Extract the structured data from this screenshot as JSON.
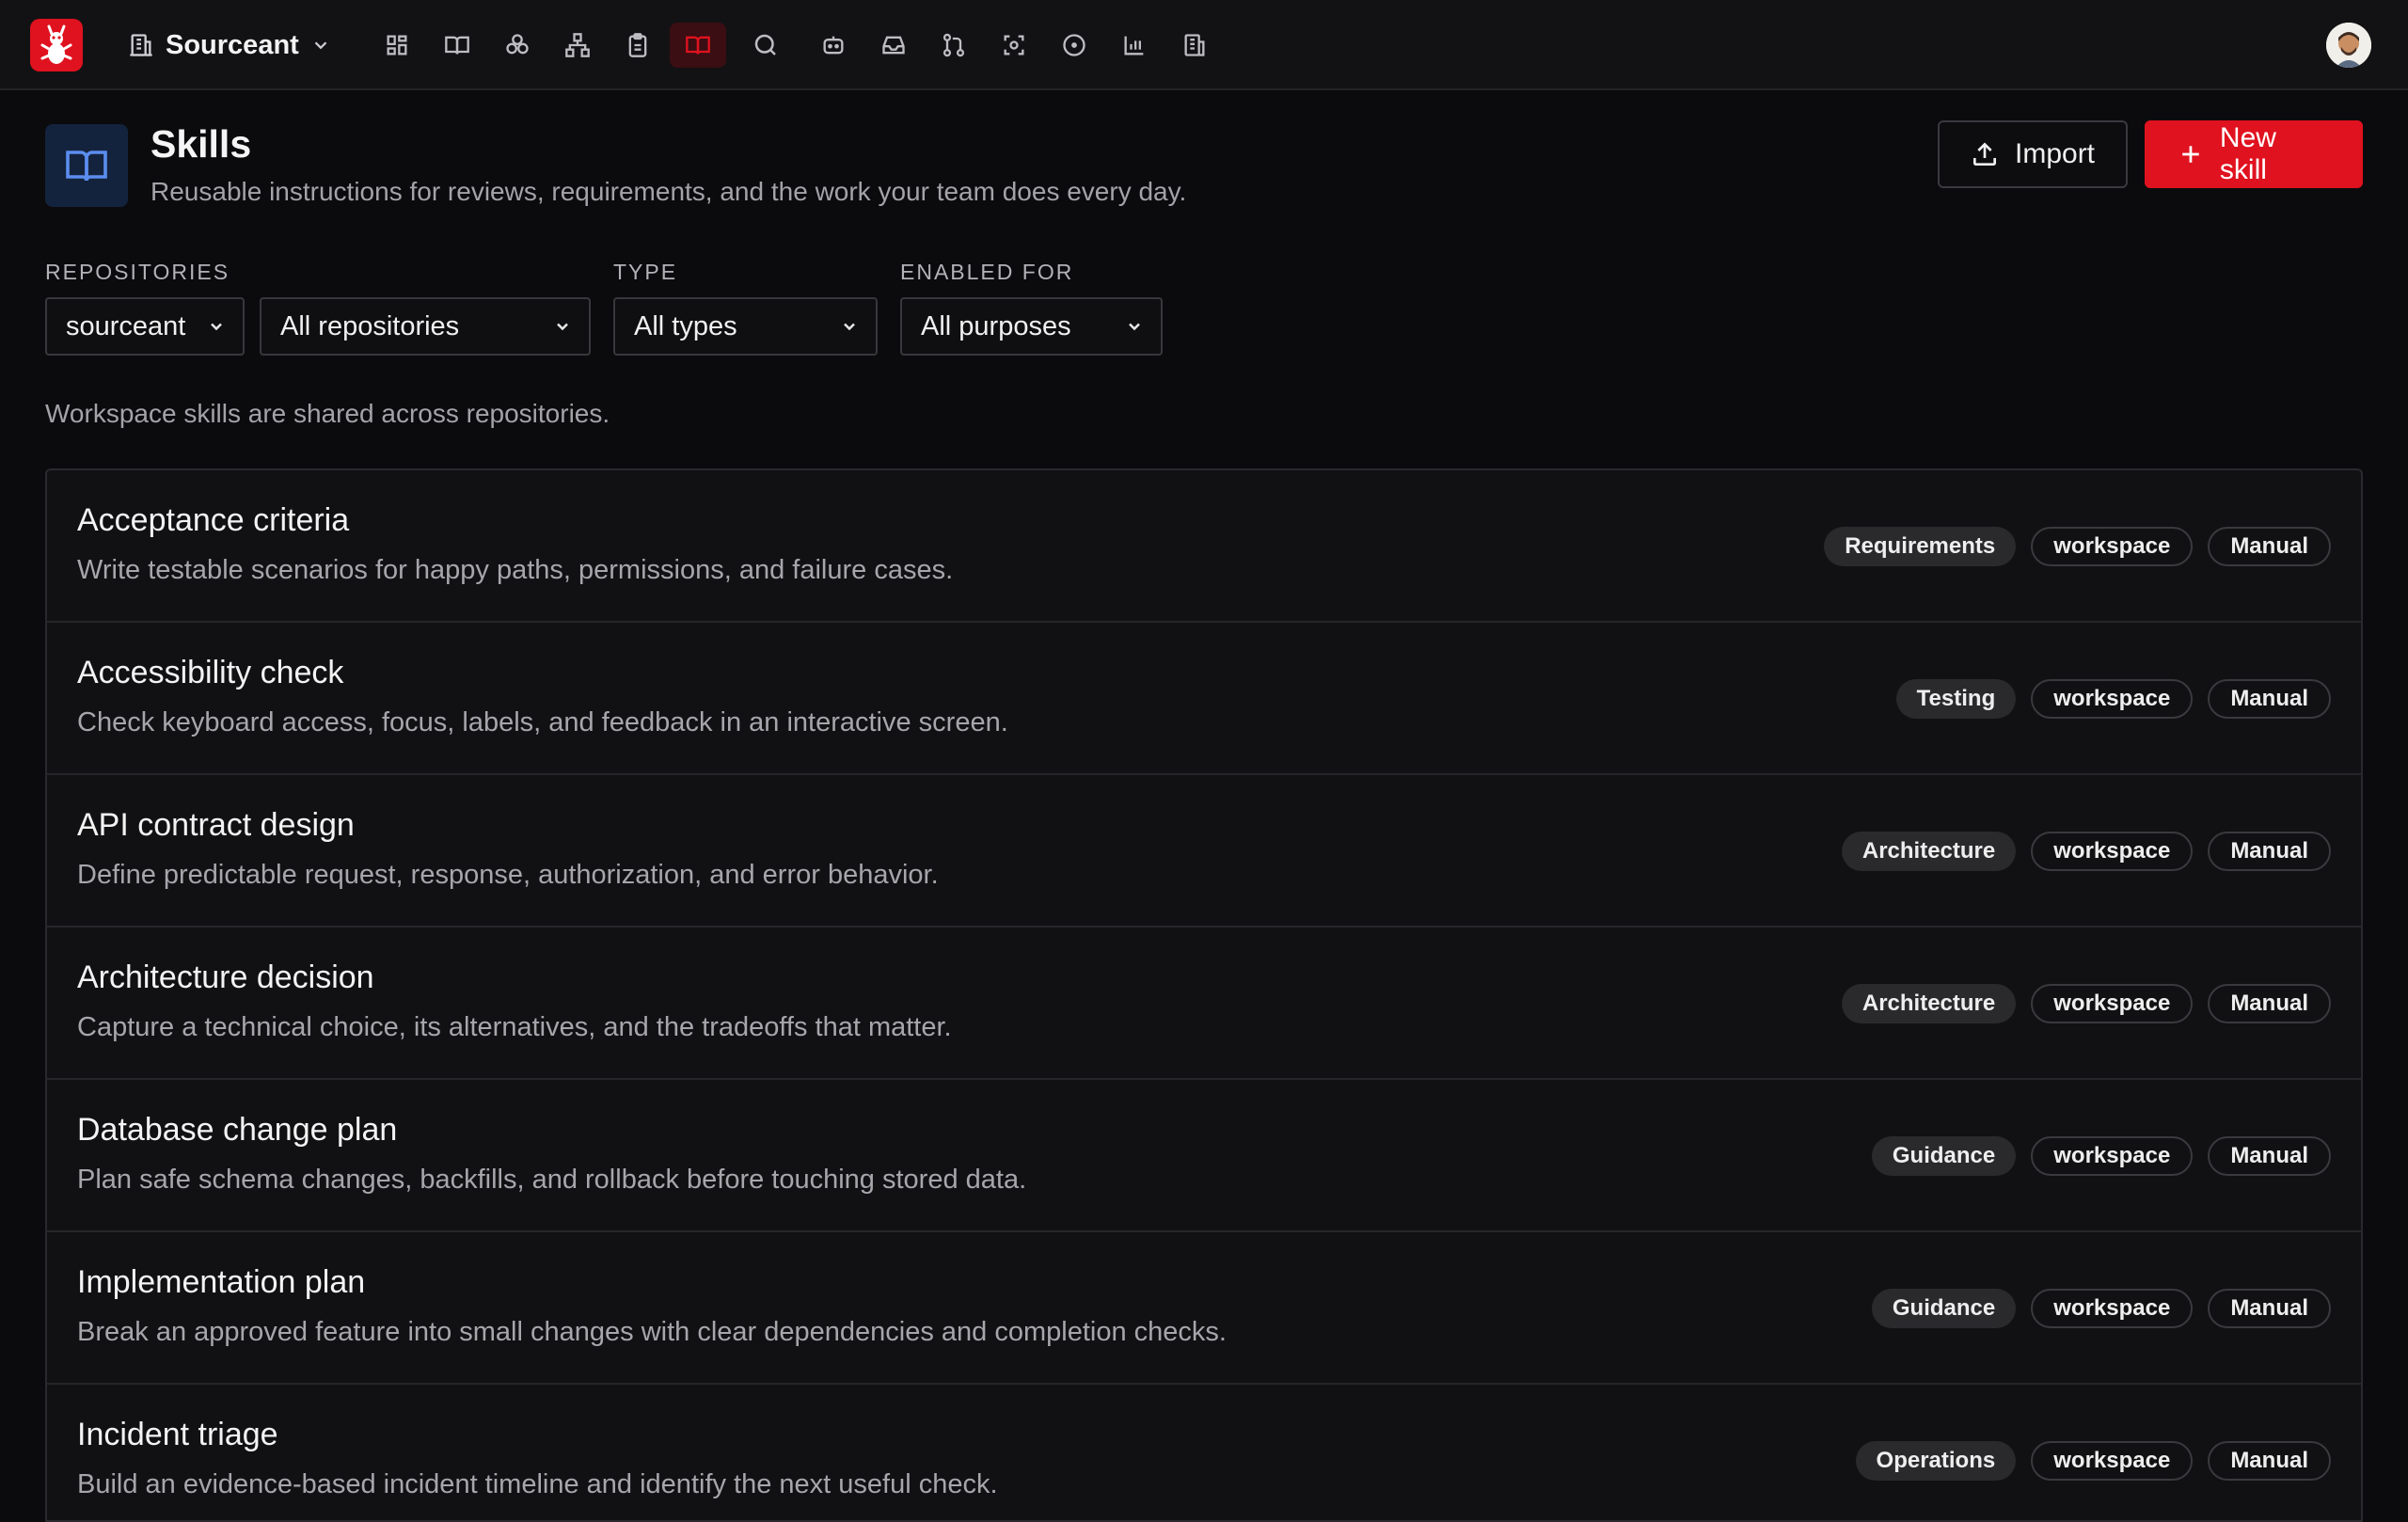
{
  "app": {
    "workspace_name": "Sourceant",
    "nav_icons": [
      "dashboard-icon",
      "book-icon",
      "boxes-icon",
      "network-icon",
      "clipboard-icon",
      "skills-book-icon",
      "search-icon",
      "chat-bot-icon",
      "inbox-icon",
      "git-pull-request-icon",
      "scan-icon",
      "circle-dot-icon",
      "bar-chart-icon",
      "building-icon"
    ],
    "active_nav": "skills-book-icon",
    "accent_color": "#e0121f"
  },
  "header": {
    "title": "Skills",
    "subtitle": "Reusable instructions for reviews, requirements, and the work your team does every day.",
    "import_label": "Import",
    "new_label": "New skill"
  },
  "filters": {
    "repositories_label": "REPOSITORIES",
    "org_value": "sourceant",
    "repo_value": "All repositories",
    "type_label": "TYPE",
    "type_value": "All types",
    "enabled_label": "ENABLED FOR",
    "enabled_value": "All purposes"
  },
  "info": "Workspace skills are shared across repositories.",
  "skills": [
    {
      "title": "Acceptance criteria",
      "desc": "Write testable scenarios for happy paths, permissions, and failure cases.",
      "category": "Requirements",
      "scope": "workspace",
      "mode": "Manual"
    },
    {
      "title": "Accessibility check",
      "desc": "Check keyboard access, focus, labels, and feedback in an interactive screen.",
      "category": "Testing",
      "scope": "workspace",
      "mode": "Manual"
    },
    {
      "title": "API contract design",
      "desc": "Define predictable request, response, authorization, and error behavior.",
      "category": "Architecture",
      "scope": "workspace",
      "mode": "Manual"
    },
    {
      "title": "Architecture decision",
      "desc": "Capture a technical choice, its alternatives, and the tradeoffs that matter.",
      "category": "Architecture",
      "scope": "workspace",
      "mode": "Manual"
    },
    {
      "title": "Database change plan",
      "desc": "Plan safe schema changes, backfills, and rollback before touching stored data.",
      "category": "Guidance",
      "scope": "workspace",
      "mode": "Manual"
    },
    {
      "title": "Implementation plan",
      "desc": "Break an approved feature into small changes with clear dependencies and completion checks.",
      "category": "Guidance",
      "scope": "workspace",
      "mode": "Manual"
    },
    {
      "title": "Incident triage",
      "desc": "Build an evidence-based incident timeline and identify the next useful check.",
      "category": "Operations",
      "scope": "workspace",
      "mode": "Manual"
    }
  ]
}
